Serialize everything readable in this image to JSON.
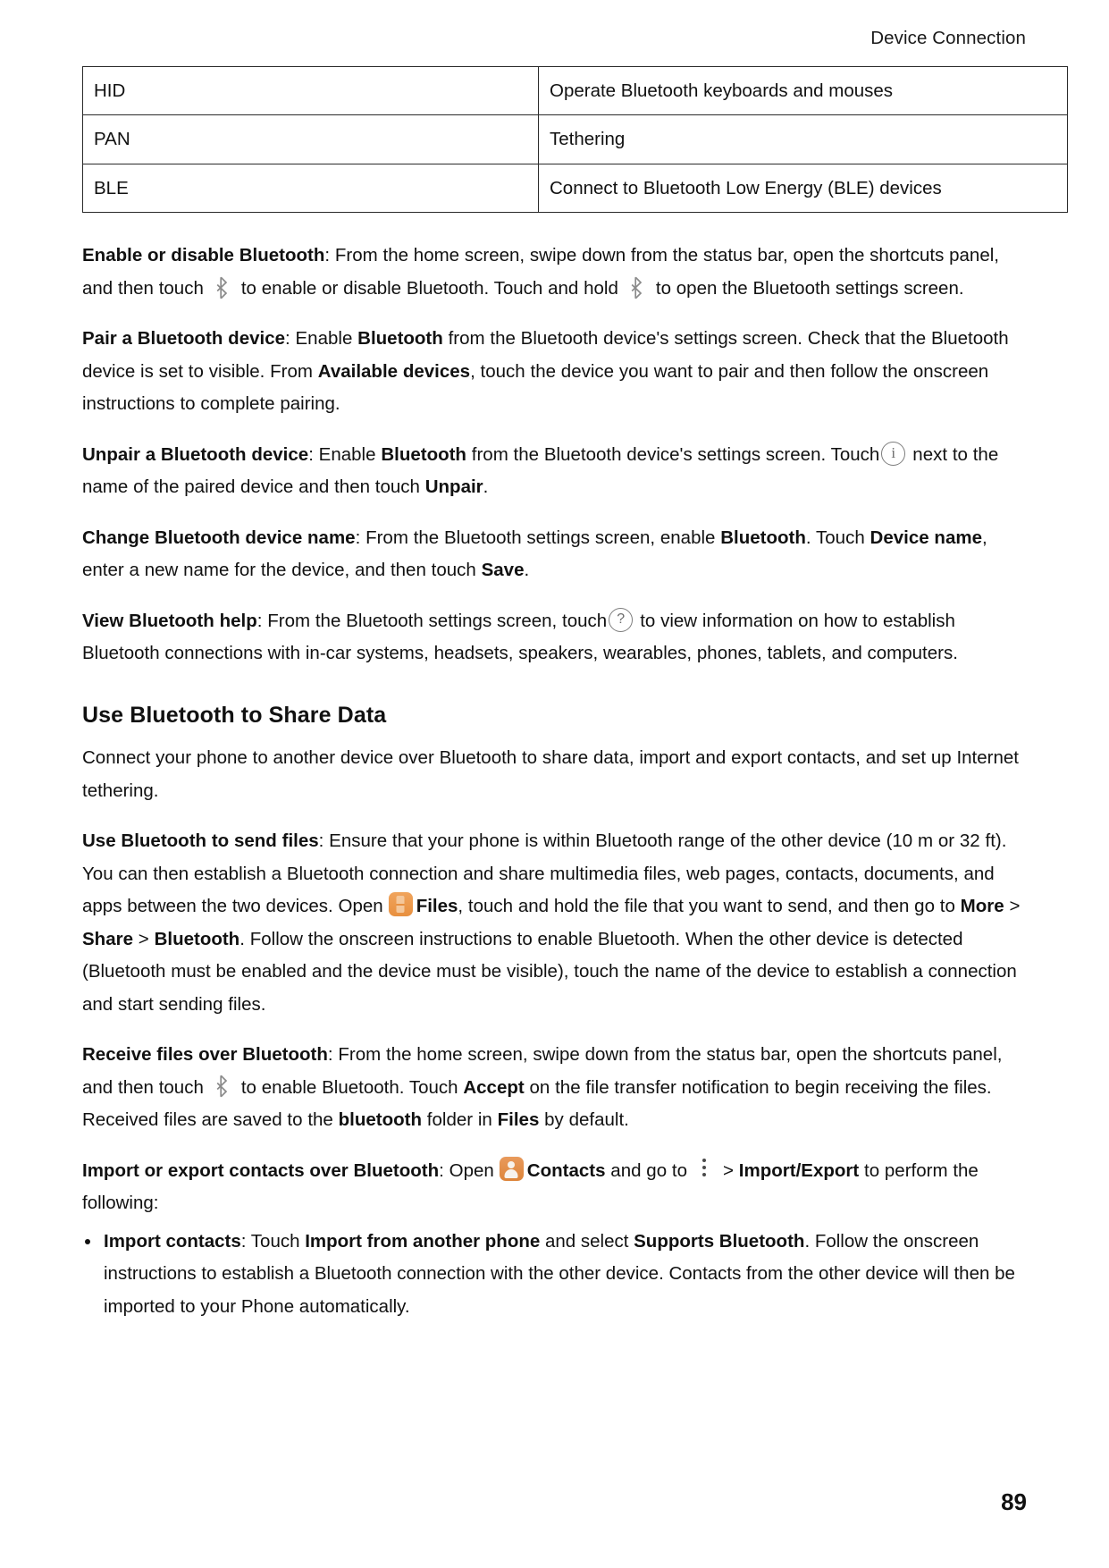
{
  "header": {
    "running_title": "Device Connection"
  },
  "table": {
    "rows": [
      {
        "key": "HID",
        "value": "Operate Bluetooth keyboards and mouses"
      },
      {
        "key": "PAN",
        "value": "Tethering"
      },
      {
        "key": "BLE",
        "value": "Connect to Bluetooth Low Energy (BLE) devices"
      }
    ]
  },
  "paragraphs": {
    "enable_disable": {
      "lead": "Enable or disable Bluetooth",
      "t1": ": From the home screen, swipe down from the status bar, open the shortcuts panel, and then touch",
      "t2": "to enable or disable Bluetooth. Touch and hold",
      "t3": "to open the Bluetooth settings screen."
    },
    "pair": {
      "lead": "Pair a Bluetooth device",
      "t1": ": Enable ",
      "b1": "Bluetooth",
      "t2": " from the Bluetooth device's settings screen. Check that the Bluetooth device is set to visible. From ",
      "b2": "Available devices",
      "t3": ", touch the device you want to pair and then follow the onscreen instructions to complete pairing."
    },
    "unpair": {
      "lead": "Unpair a Bluetooth device",
      "t1": ": Enable ",
      "b1": "Bluetooth",
      "t2": " from the Bluetooth device's settings screen. Touch",
      "t3": "next to the name of the paired device and then touch ",
      "b2": "Unpair",
      "t4": "."
    },
    "change_name": {
      "lead": "Change Bluetooth device name",
      "t1": ": From the Bluetooth settings screen, enable ",
      "b1": "Bluetooth",
      "t2": ". Touch ",
      "b2": "Device name",
      "t3": ", enter a new name for the device, and then touch ",
      "b3": "Save",
      "t4": "."
    },
    "view_help": {
      "lead": "View Bluetooth help",
      "t1": ": From the Bluetooth settings screen, touch",
      "t2": "to view information on how to establish Bluetooth connections with in-car systems, headsets, speakers, wearables, phones, tablets, and computers."
    }
  },
  "section": {
    "heading": "Use Bluetooth to Share Data",
    "intro": "Connect your phone to another device over Bluetooth to share data, import and export contacts, and set up Internet tethering.",
    "send_files": {
      "lead": "Use Bluetooth to send files",
      "t1": ": Ensure that your phone is within Bluetooth range of the other device (10 m or 32 ft). You can then establish a Bluetooth connection and share multimedia files, web pages, contacts, documents, and apps between the two devices. Open",
      "b1": "Files",
      "t2": ", touch and hold the file that you want to send, and then go to ",
      "b2": "More",
      "t3": " > ",
      "b3": "Share",
      "t4": " > ",
      "b4": "Bluetooth",
      "t5": ". Follow the onscreen instructions to enable Bluetooth. When the other device is detected (Bluetooth must be enabled and the device must be visible), touch the name of the device to establish a connection and start sending files."
    },
    "receive_files": {
      "lead": "Receive files over Bluetooth",
      "t1": ": From the home screen, swipe down from the status bar, open the shortcuts panel, and then touch",
      "t2": "to enable Bluetooth. Touch ",
      "b1": "Accept",
      "t3": " on the file transfer notification to begin receiving the files. Received files are saved to the ",
      "b2": "bluetooth",
      "t4": " folder in ",
      "b3": "Files",
      "t5": " by default."
    },
    "import_export": {
      "lead": "Import or export contacts over Bluetooth",
      "t1": ": Open",
      "b1": "Contacts",
      "t2": " and go to",
      "t3": "> ",
      "b2": "Import/Export",
      "t4": " to perform the following:"
    },
    "bullets": [
      {
        "b1": "Import contacts",
        "t1": ": Touch ",
        "b2": "Import from another phone",
        "t2": " and select ",
        "b3": "Supports Bluetooth",
        "t3": ". Follow the onscreen instructions to establish a Bluetooth connection with the other device. Contacts from the other device will then be imported to your Phone automatically."
      }
    ]
  },
  "footer": {
    "page_number": "89"
  },
  "icons": {
    "bluetooth": "bluetooth-icon",
    "info": "i",
    "help": "?",
    "files": "files-app-icon",
    "contacts": "contacts-app-icon",
    "kebab": "more-options-icon"
  },
  "colors": {
    "app_orange": "#e8903f",
    "icon_gray": "#7d7d7d",
    "text": "#111111",
    "rule": "#2a2a2a"
  }
}
